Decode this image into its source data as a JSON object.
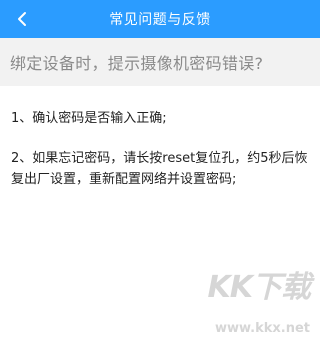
{
  "header": {
    "title": "常见问题与反馈",
    "back_icon": "chevron-left-icon",
    "background": "#2b9cff"
  },
  "faq": {
    "question": "绑定设备时，提示摄像机密码错误?",
    "answers": [
      "1、确认密码是否输入正确;",
      "2、如果忘记密码，请长按reset复位孔，约5秒后恢复出厂设置，重新配置网络并设置密码;"
    ]
  },
  "watermark": {
    "brand": "KK下载",
    "url": "www.kkx.net"
  }
}
